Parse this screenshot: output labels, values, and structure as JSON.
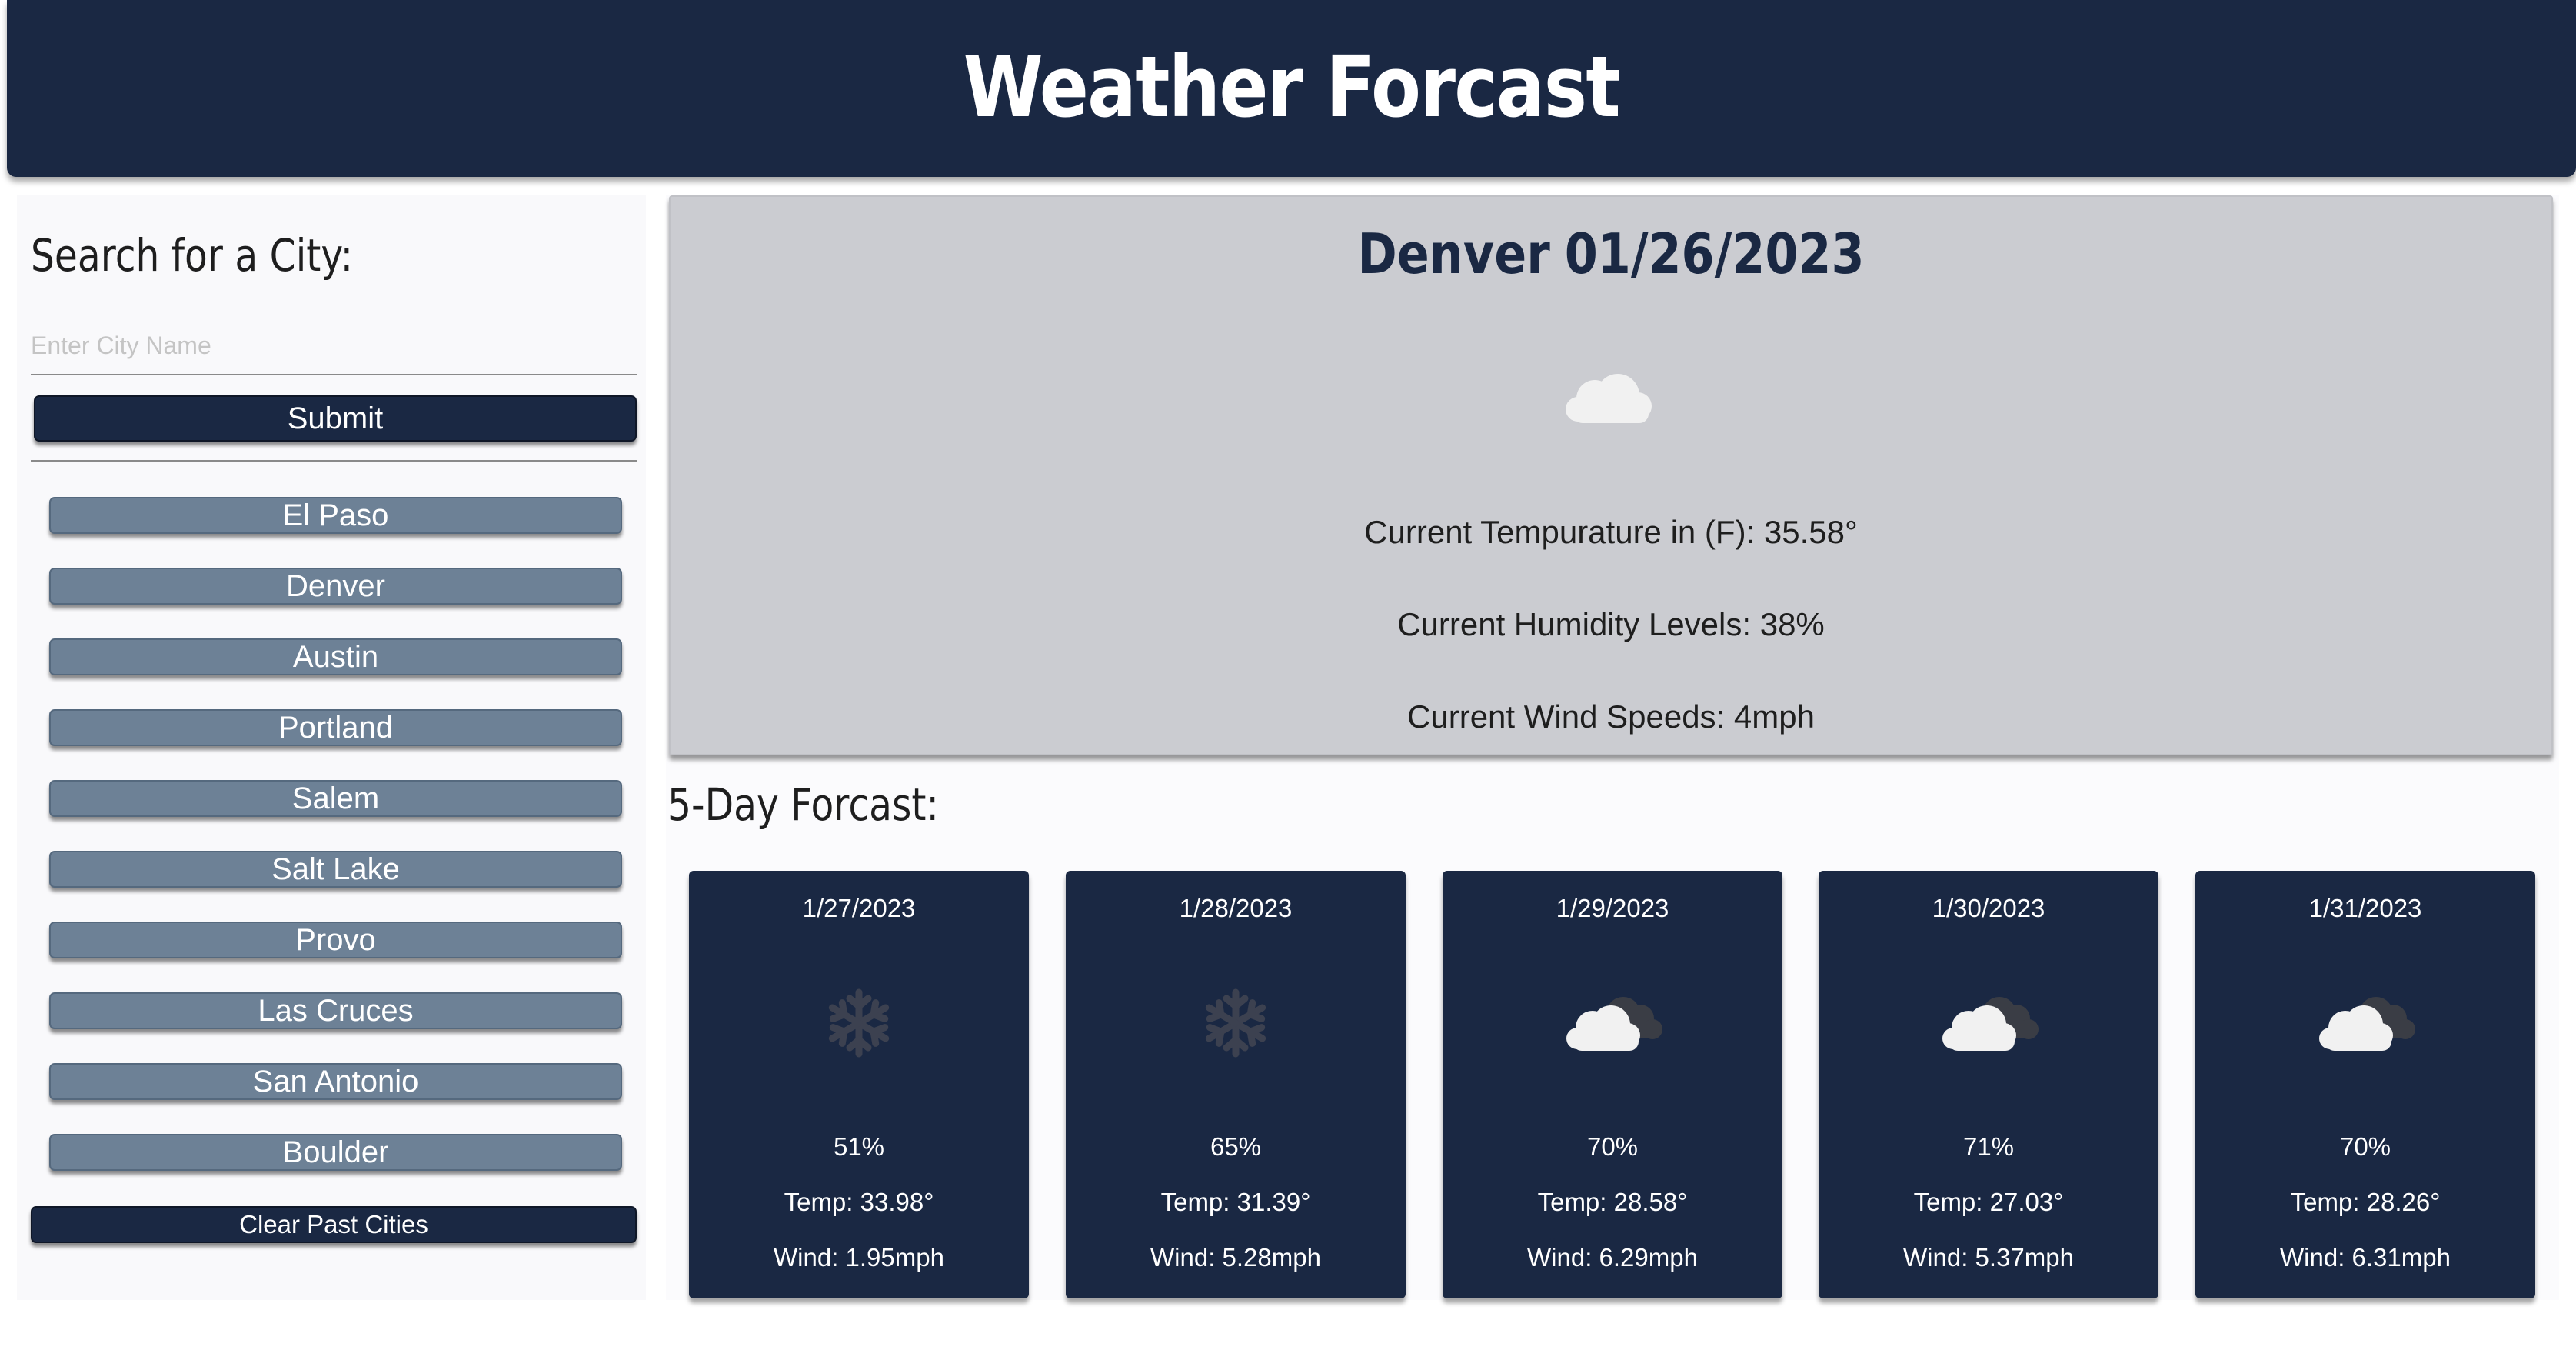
{
  "header": {
    "title": "Weather Forcast"
  },
  "sidebar": {
    "search_title": "Search for a City:",
    "input": {
      "placeholder": "Enter City Name",
      "value": ""
    },
    "submit_label": "Submit",
    "past_cities": [
      "El Paso",
      "Denver",
      "Austin",
      "Portland",
      "Salem",
      "Salt Lake",
      "Provo",
      "Las Cruces",
      "San Antonio",
      "Boulder"
    ],
    "clear_label": "Clear Past Cities"
  },
  "current": {
    "city": "Denver",
    "date": "01/26/2023",
    "icon": "cloud-icon",
    "temperature": "Current Tempurature in (F): 35.58°",
    "humidity": "Current Humidity Levels: 38%",
    "wind": "Current Wind Speeds: 4mph"
  },
  "forecast": {
    "title": "5-Day Forcast:",
    "days": [
      {
        "date": "1/27/2023",
        "icon": "snowflake-icon",
        "humidity": "51%",
        "temp": "Temp: 33.98°",
        "wind": "Wind: 1.95mph"
      },
      {
        "date": "1/28/2023",
        "icon": "snowflake-icon",
        "humidity": "65%",
        "temp": "Temp: 31.39°",
        "wind": "Wind: 5.28mph"
      },
      {
        "date": "1/29/2023",
        "icon": "clouds-icon",
        "humidity": "70%",
        "temp": "Temp: 28.58°",
        "wind": "Wind: 6.29mph"
      },
      {
        "date": "1/30/2023",
        "icon": "clouds-icon",
        "humidity": "71%",
        "temp": "Temp: 27.03°",
        "wind": "Wind: 5.37mph"
      },
      {
        "date": "1/31/2023",
        "icon": "clouds-icon",
        "humidity": "70%",
        "temp": "Temp: 28.26°",
        "wind": "Wind: 6.31mph"
      }
    ]
  },
  "colors": {
    "navy": "#1a2843",
    "city_button": "#6d8196",
    "current_panel": "#cbccd1"
  }
}
